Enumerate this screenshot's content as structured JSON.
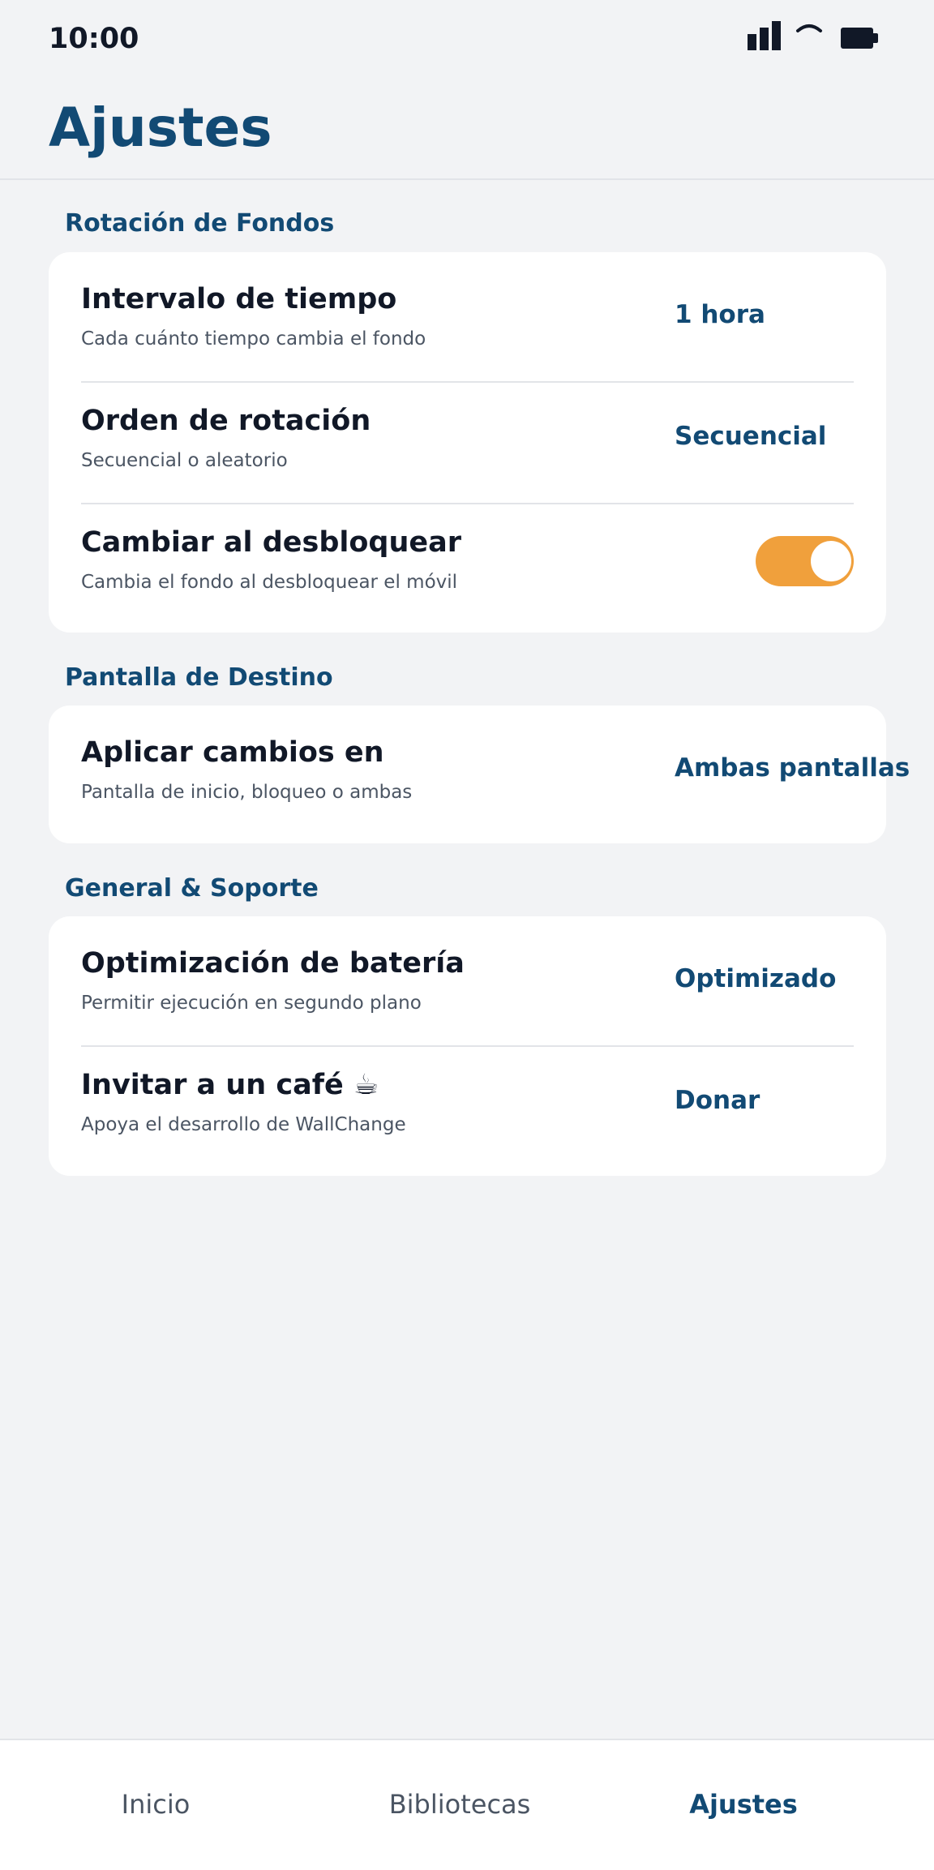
{
  "status_bar": {
    "time": "10:00",
    "icons": [
      "signal-icon",
      "wifi-icon",
      "battery-icon"
    ]
  },
  "page": {
    "title": "Ajustes"
  },
  "colors": {
    "accent": "#124a74",
    "toggle_on": "#f0a03c",
    "background": "#f2f3f5"
  },
  "sections": [
    {
      "title": "Rotación de Fondos",
      "rows": [
        {
          "title": "Intervalo de tiempo",
          "subtitle": "Cada cuánto tiempo cambia el fondo",
          "value": "1 hora"
        },
        {
          "title": "Orden de rotación",
          "subtitle": "Secuencial o aleatorio",
          "value": "Secuencial"
        },
        {
          "title": "Cambiar al desbloquear",
          "subtitle": "Cambia el fondo al desbloquear el móvil",
          "toggle_on": true
        }
      ]
    },
    {
      "title": "Pantalla de Destino",
      "rows": [
        {
          "title": "Aplicar cambios en",
          "subtitle": "Pantalla de inicio, bloqueo o ambas",
          "value": "Ambas pantallas"
        }
      ]
    },
    {
      "title": "General & Soporte",
      "rows": [
        {
          "title": "Optimización de batería",
          "subtitle": "Permitir ejecución en segundo plano",
          "value": "Optimizado"
        },
        {
          "title": "Invitar a un café ☕",
          "subtitle": "Apoya el desarrollo de WallChange",
          "value": "Donar"
        }
      ]
    }
  ],
  "bottom_nav": {
    "items": [
      {
        "label": "Inicio",
        "active": false
      },
      {
        "label": "Bibliotecas",
        "active": false
      },
      {
        "label": "Ajustes",
        "active": true
      }
    ]
  }
}
